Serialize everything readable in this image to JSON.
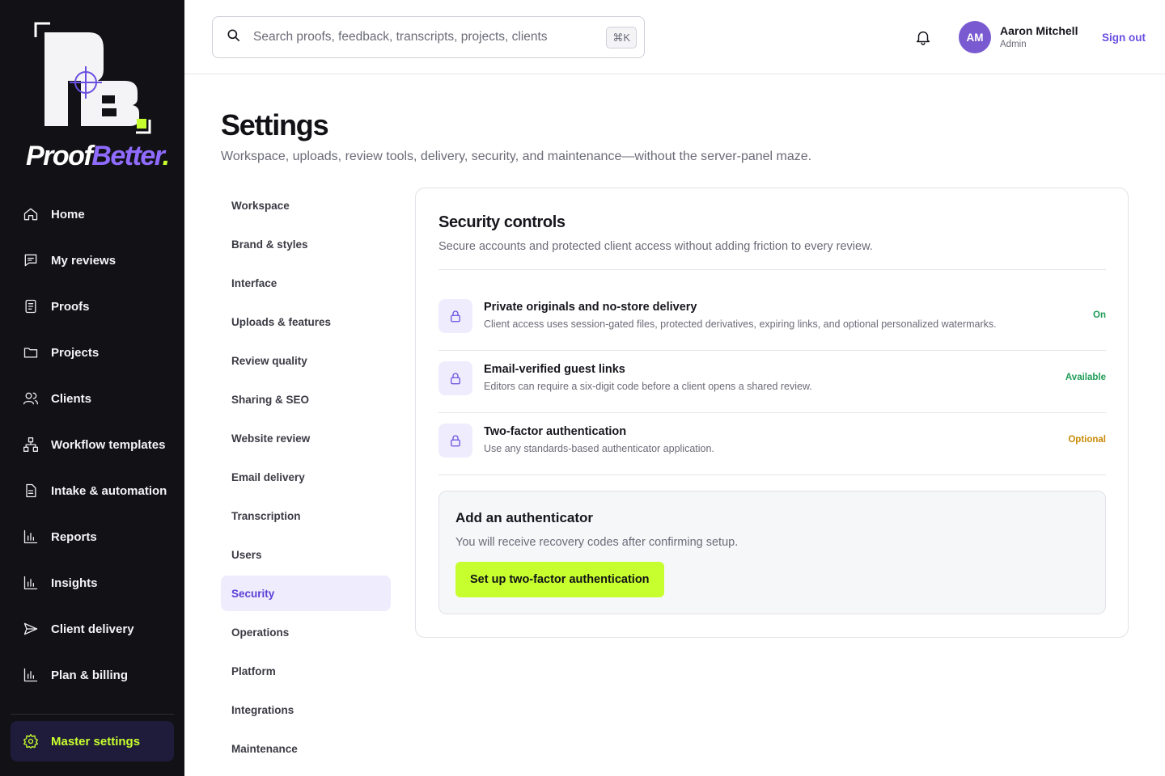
{
  "brand": {
    "name_part1": "Proof",
    "name_part2": "Better",
    "name_dot": "."
  },
  "sidebar": {
    "items": [
      {
        "label": "Home",
        "icon": "home-icon"
      },
      {
        "label": "My reviews",
        "icon": "chat-icon"
      },
      {
        "label": "Proofs",
        "icon": "document-icon"
      },
      {
        "label": "Projects",
        "icon": "folder-icon"
      },
      {
        "label": "Clients",
        "icon": "users-icon"
      },
      {
        "label": "Workflow templates",
        "icon": "workflow-icon"
      },
      {
        "label": "Intake & automation",
        "icon": "file-icon"
      },
      {
        "label": "Reports",
        "icon": "bar-chart-icon"
      },
      {
        "label": "Insights",
        "icon": "bar-chart-icon"
      },
      {
        "label": "Client delivery",
        "icon": "send-icon"
      },
      {
        "label": "Plan & billing",
        "icon": "bar-chart-icon"
      }
    ],
    "master": {
      "label": "Master settings",
      "icon": "gear-icon"
    }
  },
  "topbar": {
    "search_placeholder": "Search proofs, feedback, transcripts, projects, clients",
    "search_shortcut": "⌘K",
    "user": {
      "initials": "AM",
      "name": "Aaron Mitchell",
      "role": "Admin"
    },
    "signout": "Sign out"
  },
  "page": {
    "title": "Settings",
    "subtitle": "Workspace, uploads, review tools, delivery, security, and maintenance—without the server-panel maze."
  },
  "subnav": {
    "items": [
      "Workspace",
      "Brand & styles",
      "Interface",
      "Uploads & features",
      "Review quality",
      "Sharing & SEO",
      "Website review",
      "Email delivery",
      "Transcription",
      "Users",
      "Security",
      "Operations",
      "Platform",
      "Integrations",
      "Maintenance"
    ],
    "active": "Security"
  },
  "security": {
    "title": "Security controls",
    "subtitle": "Secure accounts and protected client access without adding friction to every review.",
    "rows": [
      {
        "title": "Private originals and no-store delivery",
        "desc": "Client access uses session-gated files, protected derivatives, expiring links, and optional personalized watermarks.",
        "status": "On",
        "status_color": "#1f9d57"
      },
      {
        "title": "Email-verified guest links",
        "desc": "Editors can require a six-digit code before a client opens a shared review.",
        "status": "Available",
        "status_color": "#1f9d57"
      },
      {
        "title": "Two-factor authentication",
        "desc": "Use any standards-based authenticator application.",
        "status": "Optional",
        "status_color": "#c98a06"
      }
    ],
    "authenticator": {
      "title": "Add an authenticator",
      "subtitle": "You will receive recovery codes after confirming setup.",
      "button": "Set up two-factor authentication"
    }
  },
  "colors": {
    "accent": "#c7ff2e",
    "brand_purple": "#6a4ee0",
    "sidebar_bg": "#111116"
  }
}
